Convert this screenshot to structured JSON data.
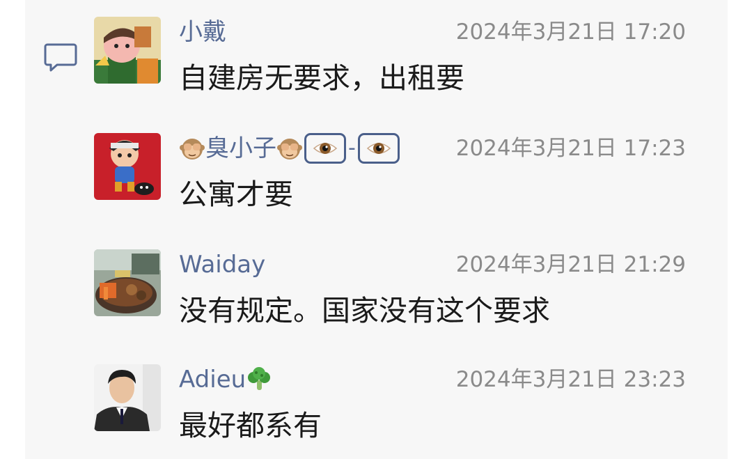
{
  "comments": [
    {
      "name": "小戴",
      "time": "2024年3月21日 17:20",
      "text": "自建房无要求，出租要"
    },
    {
      "name": "臭小子",
      "time": "2024年3月21日 17:23",
      "text": "公寓才要",
      "name_dash": "-",
      "name_icons": [
        "see-no-evil-monkey-icon",
        "see-no-evil-monkey-icon",
        "eye-icon",
        "eye-icon"
      ]
    },
    {
      "name": "Waiday",
      "time": "2024年3月21日 21:29",
      "text": "没有规定。国家没有这个要求"
    },
    {
      "name": "Adieu",
      "time": "2024年3月21日 23:23",
      "text": "最好都系有",
      "name_icons": [
        "broccoli-icon"
      ]
    }
  ],
  "icons": {
    "comment": "comment-bubble-icon"
  },
  "colors": {
    "name": "#576b95",
    "time": "#8a8a8a",
    "text": "#1a1a1a",
    "panel": "#f7f7f7"
  }
}
